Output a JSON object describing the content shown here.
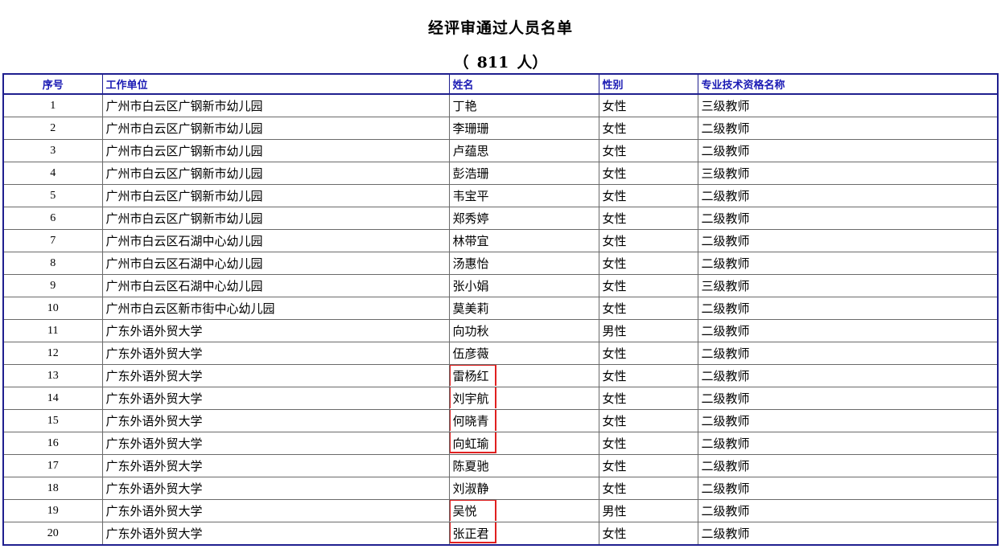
{
  "document": {
    "title": "经评审通过人员名单",
    "count_open": "（",
    "count_value": "811",
    "count_unit": "人）"
  },
  "table": {
    "headers": {
      "seq": "序号",
      "unit": "工作单位",
      "name": "姓名",
      "gender": "性别",
      "qualification": "专业技术资格名称"
    },
    "rows": [
      {
        "seq": "1",
        "unit": "广州市白云区广钢新市幼儿园",
        "name": "丁艳",
        "gender": "女性",
        "qualification": "三级教师"
      },
      {
        "seq": "2",
        "unit": "广州市白云区广钢新市幼儿园",
        "name": "李珊珊",
        "gender": "女性",
        "qualification": "二级教师"
      },
      {
        "seq": "3",
        "unit": "广州市白云区广钢新市幼儿园",
        "name": "卢蕴思",
        "gender": "女性",
        "qualification": "二级教师"
      },
      {
        "seq": "4",
        "unit": "广州市白云区广钢新市幼儿园",
        "name": "彭浩珊",
        "gender": "女性",
        "qualification": "三级教师"
      },
      {
        "seq": "5",
        "unit": "广州市白云区广钢新市幼儿园",
        "name": "韦宝平",
        "gender": "女性",
        "qualification": "二级教师"
      },
      {
        "seq": "6",
        "unit": "广州市白云区广钢新市幼儿园",
        "name": "郑秀婷",
        "gender": "女性",
        "qualification": "二级教师"
      },
      {
        "seq": "7",
        "unit": "广州市白云区石湖中心幼儿园",
        "name": "林带宜",
        "gender": "女性",
        "qualification": "二级教师"
      },
      {
        "seq": "8",
        "unit": "广州市白云区石湖中心幼儿园",
        "name": "汤惠怡",
        "gender": "女性",
        "qualification": "二级教师"
      },
      {
        "seq": "9",
        "unit": "广州市白云区石湖中心幼儿园",
        "name": "张小娟",
        "gender": "女性",
        "qualification": "三级教师"
      },
      {
        "seq": "10",
        "unit": "广州市白云区新市街中心幼儿园",
        "name": "莫美莉",
        "gender": "女性",
        "qualification": "二级教师"
      },
      {
        "seq": "11",
        "unit": "广东外语外贸大学",
        "name": "向功秋",
        "gender": "男性",
        "qualification": "二级教师"
      },
      {
        "seq": "12",
        "unit": "广东外语外贸大学",
        "name": "伍彦薇",
        "gender": "女性",
        "qualification": "二级教师"
      },
      {
        "seq": "13",
        "unit": "广东外语外贸大学",
        "name": "雷杨红",
        "gender": "女性",
        "qualification": "二级教师"
      },
      {
        "seq": "14",
        "unit": "广东外语外贸大学",
        "name": "刘宇航",
        "gender": "女性",
        "qualification": "二级教师"
      },
      {
        "seq": "15",
        "unit": "广东外语外贸大学",
        "name": "何晓青",
        "gender": "女性",
        "qualification": "二级教师"
      },
      {
        "seq": "16",
        "unit": "广东外语外贸大学",
        "name": "向虹瑜",
        "gender": "女性",
        "qualification": "二级教师"
      },
      {
        "seq": "17",
        "unit": "广东外语外贸大学",
        "name": "陈夏驰",
        "gender": "女性",
        "qualification": "二级教师"
      },
      {
        "seq": "18",
        "unit": "广东外语外贸大学",
        "name": "刘淑静",
        "gender": "女性",
        "qualification": "二级教师"
      },
      {
        "seq": "19",
        "unit": "广东外语外贸大学",
        "name": "吴悦",
        "gender": "男性",
        "qualification": "二级教师"
      },
      {
        "seq": "20",
        "unit": "广东外语外贸大学",
        "name": "张正君",
        "gender": "女性",
        "qualification": "二级教师"
      }
    ],
    "highlighted_names": [
      {
        "seq": "13",
        "edge": "top"
      },
      {
        "seq": "14",
        "edge": "middle"
      },
      {
        "seq": "15",
        "edge": "middle"
      },
      {
        "seq": "16",
        "edge": "bottom"
      },
      {
        "seq": "19",
        "edge": "top"
      },
      {
        "seq": "20",
        "edge": "bottom"
      }
    ],
    "highlight_color": "#e02020",
    "header_text_color": "#1a1ab4",
    "border_color": "#1f1f8f"
  }
}
